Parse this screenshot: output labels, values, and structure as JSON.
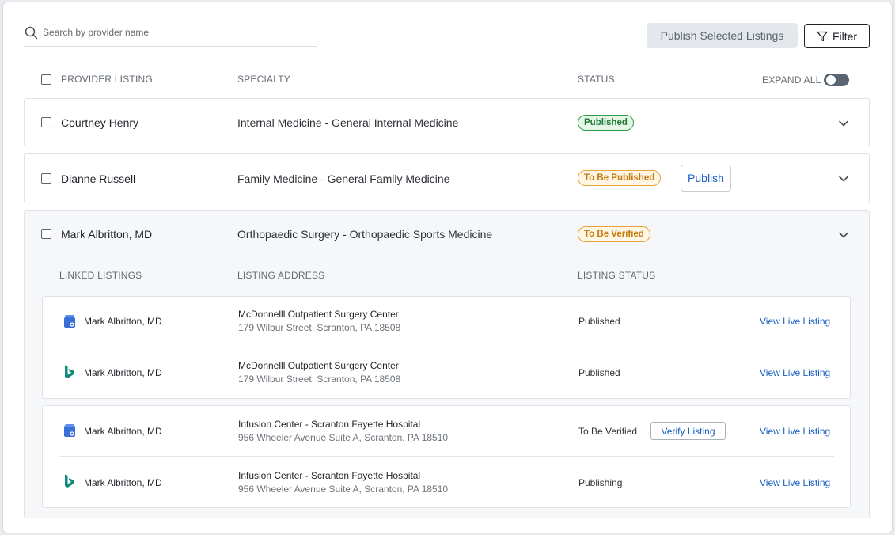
{
  "search": {
    "placeholder": "Search by provider name"
  },
  "toolbar": {
    "publish_selected_label": "Publish Selected Listings",
    "filter_label": "Filter"
  },
  "columns": {
    "provider": "PROVIDER LISTING",
    "specialty": "SPECIALTY",
    "status": "STATUS",
    "expand_all": "EXPAND ALL"
  },
  "providers": [
    {
      "name": "Courtney Henry",
      "specialty": "Internal Medicine - General Internal Medicine",
      "status": "Published"
    },
    {
      "name": "Dianne Russell",
      "specialty": "Family Medicine - General Family Medicine",
      "status": "To Be Published",
      "action": "Publish"
    },
    {
      "name": "Mark Albritton, MD",
      "specialty": "Orthopaedic Surgery - Orthopaedic Sports Medicine",
      "status": "To Be Verified"
    }
  ],
  "sub_columns": {
    "linked": "LINKED LISTINGS",
    "address": "LISTING ADDRESS",
    "status": "LISTING STATUS"
  },
  "linked": [
    {
      "icon": "google-business-icon",
      "name": "Mark Albritton, MD",
      "addr1": "McDonnelll Outpatient Surgery Center",
      "addr2": "179 Wilbur Street, Scranton, PA 18508",
      "status": "Published",
      "link": "View Live Listing"
    },
    {
      "icon": "bing-icon",
      "name": "Mark Albritton, MD",
      "addr1": "McDonnelll Outpatient Surgery Center",
      "addr2": "179 Wilbur Street, Scranton, PA 18508",
      "status": "Published",
      "link": "View Live Listing"
    },
    {
      "icon": "google-business-icon",
      "name": "Mark Albritton, MD",
      "addr1": "Infusion Center - Scranton Fayette Hospital",
      "addr2": "956 Wheeler Avenue Suite A, Scranton, PA 18510",
      "status": "To Be Verified",
      "action": "Verify Listing",
      "link": "View Live Listing"
    },
    {
      "icon": "bing-icon",
      "name": "Mark Albritton, MD",
      "addr1": "Infusion Center - Scranton Fayette Hospital",
      "addr2": "956 Wheeler Avenue Suite A, Scranton, PA 18510",
      "status": "Publishing",
      "link": "View Live Listing"
    }
  ],
  "colors": {
    "link": "#1a5fc4",
    "published": "#2e9e46",
    "pending": "#e6a13a",
    "bing": "#0f8a7a",
    "google": "#3b6fd8"
  }
}
